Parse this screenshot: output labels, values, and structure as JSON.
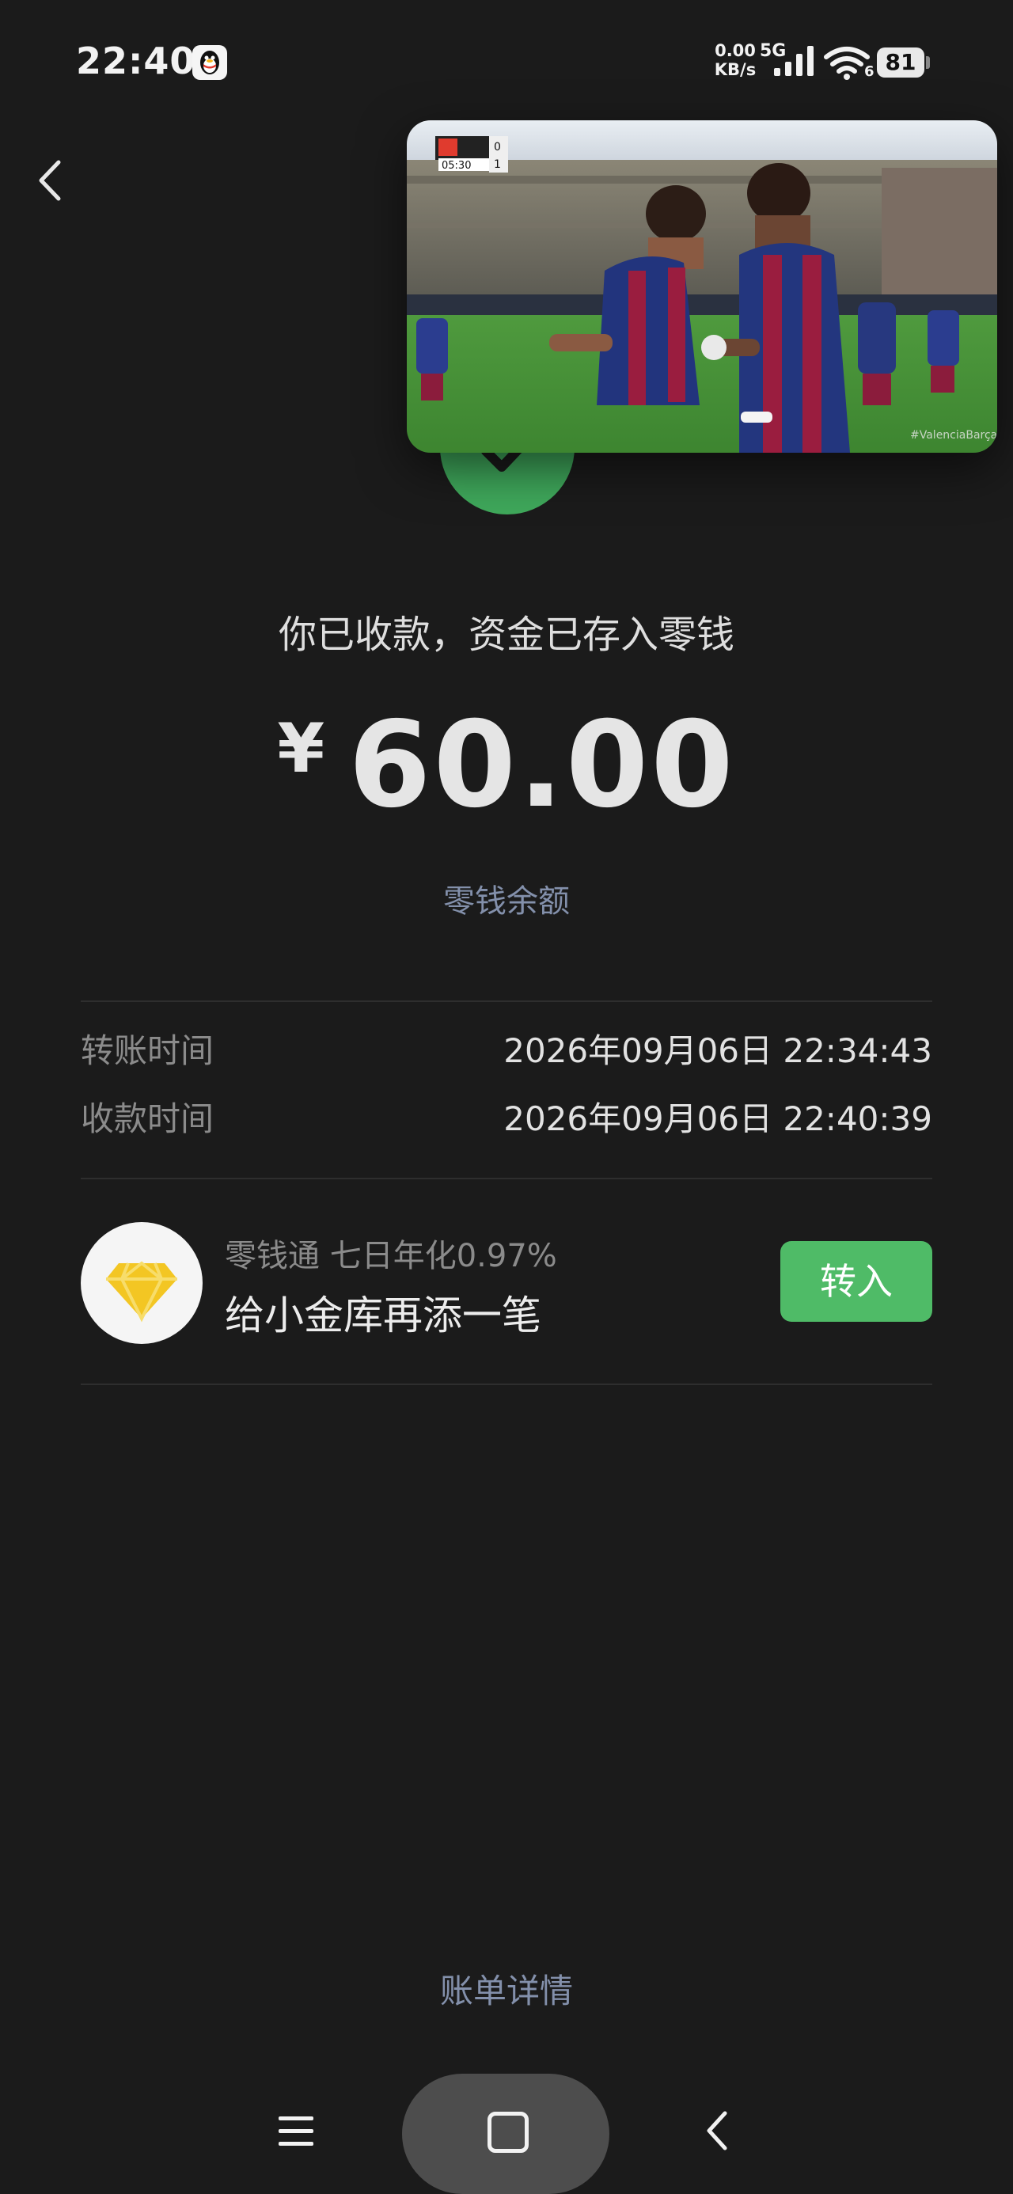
{
  "status_bar": {
    "time": "22:40",
    "net_speed_value": "0.00",
    "net_speed_unit": "KB/s",
    "network_type": "5G",
    "wifi_label": "6",
    "battery": "81"
  },
  "header": {
    "back_icon": "chevron-left-icon"
  },
  "pip_video": {
    "description_icon": "video-overlay",
    "scoreboard_time": "05:30",
    "score_home": "0",
    "score_away": "1",
    "watermark": "#ValenciaBarça"
  },
  "receipt": {
    "status_text": "你已收款，资金已存入零钱",
    "currency": "¥",
    "amount": "60.00",
    "balance_link": "零钱余额"
  },
  "details": [
    {
      "label": "转账时间",
      "value": "2026年09月06日 22:34:43"
    },
    {
      "label": "收款时间",
      "value": "2026年09月06日 22:40:39"
    }
  ],
  "promo": {
    "subtitle": "零钱通 七日年化0.97%",
    "title": "给小金库再添一笔",
    "button": "转入",
    "icon": "diamond-icon"
  },
  "footer": {
    "bill_link": "账单详情"
  },
  "colors": {
    "background": "#1b1b1b",
    "accent_green": "#4fbb67",
    "link_blue": "#8390ab",
    "diamond_gold": "#f3c623"
  }
}
